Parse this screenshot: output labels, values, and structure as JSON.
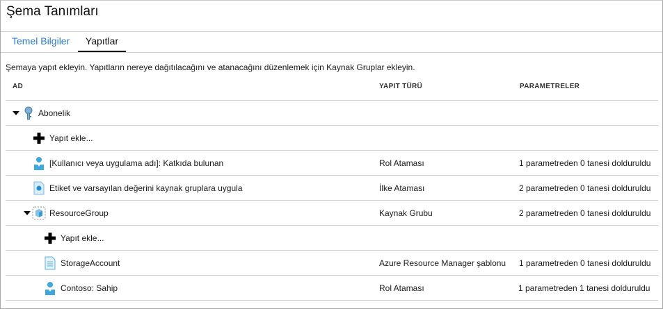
{
  "title": "Şema Tanımları",
  "tabs": [
    {
      "label": "Temel Bilgiler"
    },
    {
      "label": "Yapıtlar"
    }
  ],
  "description": "Şemaya yapıt ekleyin. Yapıtların nereye dağıtılacağını ve atanacağını düzenlemek için Kaynak Gruplar ekleyin.",
  "columns": {
    "name": "AD",
    "type": "YAPIT TÜRÜ",
    "params": "PARAMETRELER"
  },
  "rows": [
    {
      "name": "Abonelik",
      "type": "",
      "params": "",
      "icon": "key-icon"
    },
    {
      "name": "Yapıt ekle...",
      "type": "",
      "params": "",
      "icon": "plus-icon"
    },
    {
      "name": "[Kullanıcı veya uygulama adı]: Katkıda bulunan",
      "type": "Rol Ataması",
      "params": "1 parametreden 0 tanesi dolduruldu",
      "icon": "user-icon"
    },
    {
      "name": "Etiket ve varsayılan değerini kaynak gruplara uygula",
      "type": "İlke Ataması",
      "params": "2 parametreden 0 tanesi dolduruldu",
      "icon": "policy-icon"
    },
    {
      "name": "ResourceGroup",
      "type": "Kaynak Grubu",
      "params": "2 parametreden 0 tanesi dolduruldu",
      "icon": "resource-group-icon"
    },
    {
      "name": "Yapıt ekle...",
      "type": "",
      "params": "",
      "icon": "plus-icon"
    },
    {
      "name": "StorageAccount",
      "type": "Azure Resource Manager şablonu",
      "params": "1 parametreden 0 tanesi dolduruldu",
      "icon": "template-icon"
    },
    {
      "name": "Contoso: Sahip",
      "type": "Rol Ataması",
      "params": "1 parametreden 1 tanesi dolduruldu",
      "icon": "user-icon"
    }
  ]
}
